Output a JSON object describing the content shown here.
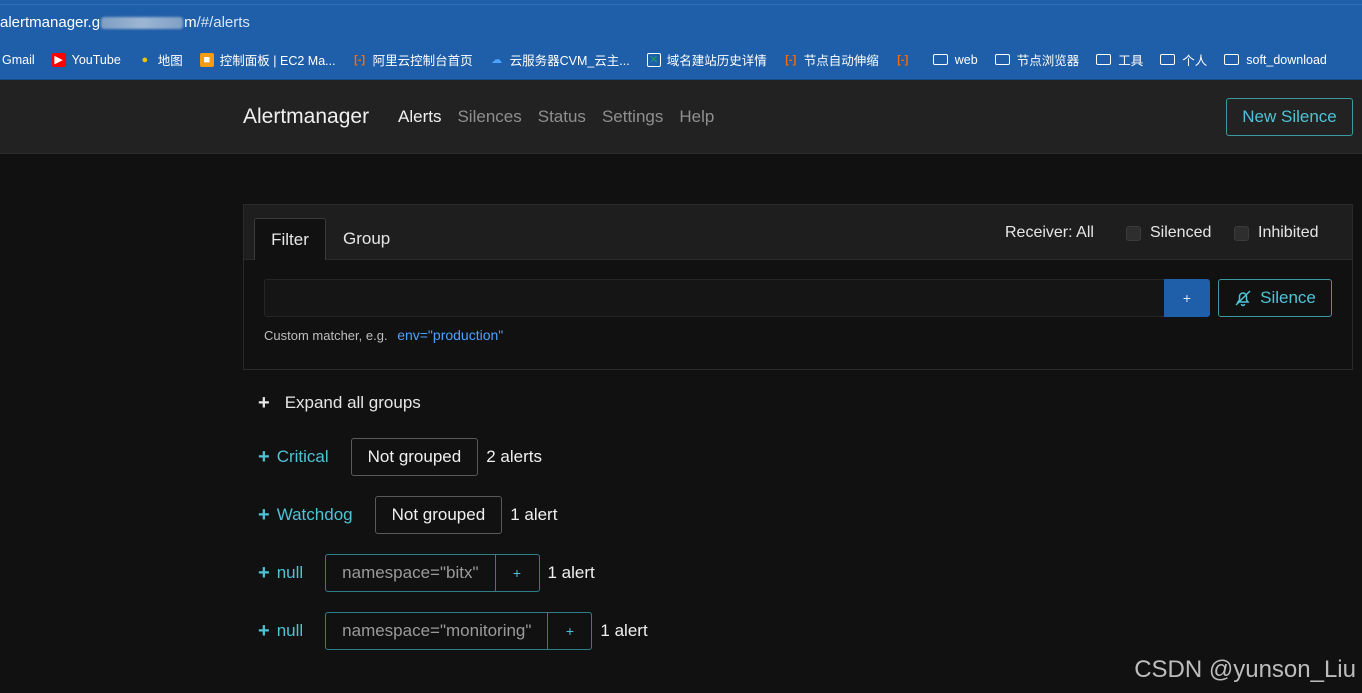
{
  "browser": {
    "url_host": "alertmanager.gtfbitwfdb.com",
    "url_visible_start": "alertmanager.g",
    "url_visible_end": "m",
    "url_path": "/#/alerts",
    "bookmarks": [
      {
        "label": "Gmail",
        "icon": "gmail-icon"
      },
      {
        "label": "YouTube",
        "icon": "youtube-icon"
      },
      {
        "label": "地图",
        "icon": "map-pin-icon"
      },
      {
        "label": "控制面板 | EC2 Ma...",
        "icon": "console-icon"
      },
      {
        "label": "阿里云控制台首页",
        "icon": "aliyun-icon"
      },
      {
        "label": "云服务器CVM_云主...",
        "icon": "cloud-icon"
      },
      {
        "label": "域名建站历史详情",
        "icon": "box-icon"
      },
      {
        "label": "节点自动伸缩",
        "icon": "aliyun-icon"
      },
      {
        "label": "",
        "icon": "aliyun-icon"
      },
      {
        "label": "web",
        "icon": "folder-icon"
      },
      {
        "label": "节点浏览器",
        "icon": "folder-icon"
      },
      {
        "label": "工具",
        "icon": "folder-icon"
      },
      {
        "label": "个人",
        "icon": "folder-icon"
      },
      {
        "label": "soft_download",
        "icon": "folder-icon"
      }
    ]
  },
  "navbar": {
    "brand": "Alertmanager",
    "links": [
      {
        "label": "Alerts",
        "active": true
      },
      {
        "label": "Silences",
        "active": false
      },
      {
        "label": "Status",
        "active": false
      },
      {
        "label": "Settings",
        "active": false
      },
      {
        "label": "Help",
        "active": false
      }
    ],
    "new_silence": "New Silence"
  },
  "filter": {
    "tab_filter": "Filter",
    "tab_group": "Group",
    "receiver": "Receiver: All",
    "silenced_label": "Silenced",
    "inhibited_label": "Inhibited",
    "input_value": "",
    "plus_label": "+",
    "silence_button": "Silence",
    "hint_text": "Custom matcher, e.g.",
    "hint_example": "env=\"production\""
  },
  "groups": {
    "expand_all": "Expand all groups",
    "items": [
      {
        "name": "Critical",
        "tag": "Not grouped",
        "count": "2 alerts"
      },
      {
        "name": "Watchdog",
        "tag": "Not grouped",
        "count": "1 alert"
      },
      {
        "name": "null",
        "matcher": "namespace=\"bitx\"",
        "add": "+",
        "count": "1 alert"
      },
      {
        "name": "null",
        "matcher": "namespace=\"monitoring\"",
        "add": "+",
        "count": "1 alert"
      }
    ]
  },
  "watermark": "CSDN @yunson_Liu",
  "colors": {
    "accent": "#4fc3d6",
    "primary_button": "#1f5ea8",
    "background": "#111111",
    "navbar": "#222222"
  }
}
